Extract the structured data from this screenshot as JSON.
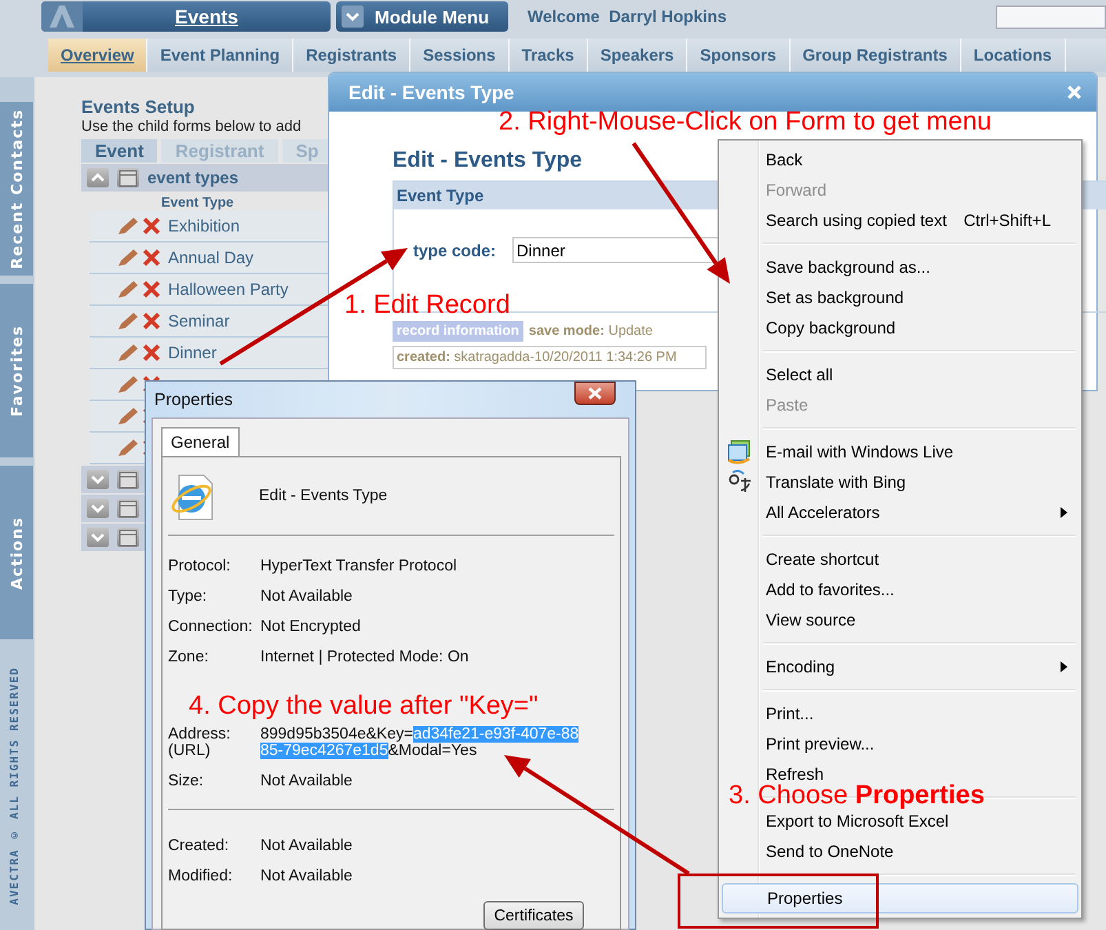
{
  "header": {
    "module": "Events",
    "module_menu": "Module Menu",
    "welcome": "Welcome  Darryl Hopkins"
  },
  "tabs": [
    {
      "label": "Overview",
      "selected": true
    },
    {
      "label": "Event Planning",
      "selected": false
    },
    {
      "label": "Registrants",
      "selected": false
    },
    {
      "label": "Sessions",
      "selected": false
    },
    {
      "label": "Tracks",
      "selected": false
    },
    {
      "label": "Speakers",
      "selected": false
    },
    {
      "label": "Sponsors",
      "selected": false
    },
    {
      "label": "Group Registrants",
      "selected": false
    },
    {
      "label": "Locations",
      "selected": false
    }
  ],
  "sidebar": {
    "tabs": [
      "Recent Contacts",
      "Favorites",
      "Actions"
    ],
    "footer": "AVECTRA © ALL RIGHTS RESERVED"
  },
  "events_setup": {
    "title": "Events Setup",
    "description": "Use the child forms below to add",
    "subtabs": [
      {
        "label": "Event",
        "selected": true
      },
      {
        "label": "Registrant",
        "selected": false
      },
      {
        "label": "Sp",
        "selected": false
      }
    ],
    "sections": [
      {
        "title": "event types",
        "expanded": true,
        "column": "Event Type",
        "rows": [
          {
            "name": "Exhibition"
          },
          {
            "name": "Annual Day"
          },
          {
            "name": "Halloween Party"
          },
          {
            "name": "Seminar"
          },
          {
            "name": "Dinner"
          },
          {},
          {},
          {}
        ]
      },
      {
        "expanded": false
      },
      {
        "expanded": false
      },
      {
        "expanded": false
      }
    ]
  },
  "edit_dialog": {
    "title": "Edit - Events Type",
    "heading": "Edit - Events Type",
    "section": "Event Type",
    "field": {
      "label": "type code:",
      "value": "Dinner"
    },
    "record_info": {
      "label": "record information",
      "save_mode": "**save mode:** Update",
      "created": "**created:** skatragadda-10/20/2011 1:34:26 PM"
    }
  },
  "properties_dialog": {
    "title": "Properties",
    "tabs": [
      {
        "label": "General",
        "selected": true
      }
    ],
    "name": "Edit - Events Type",
    "fields": [
      {
        "kind": "field",
        "label": "Protocol:",
        "value": "HyperText Transfer Protocol"
      },
      {
        "kind": "field",
        "label": "Type:",
        "value": "Not Available"
      },
      {
        "kind": "field",
        "label": "Connection:",
        "value": "Not Encrypted"
      },
      {
        "kind": "field",
        "label": "Zone:",
        "value": "Internet | Protected Mode: On"
      },
      {
        "kind": "address",
        "label": "Address:",
        "sublabel": "(URL)",
        "parts": [
          {
            "text": "899d95b3504e&Key=",
            "selected": false
          },
          {
            "text": "ad34fe21-e93f-407e-8885-79ec4267e1d5",
            "selected": true
          },
          {
            "text": "&Modal=Yes",
            "selected": false
          }
        ]
      },
      {
        "kind": "field",
        "label": "Size:",
        "value": "Not Available"
      },
      {
        "kind": "separator"
      },
      {
        "kind": "field",
        "label": "Created:",
        "value": "Not Available"
      },
      {
        "kind": "field",
        "label": "Modified:",
        "value": "Not Available"
      }
    ],
    "buttons": [
      "Certificates"
    ]
  },
  "context_menu": {
    "items": [
      {
        "kind": "item",
        "label": "Back",
        "disabled": false,
        "selected": false,
        "submenu": false
      },
      {
        "kind": "item",
        "label": "Forward",
        "disabled": true,
        "selected": false,
        "submenu": false
      },
      {
        "kind": "item",
        "label": "Search using copied text",
        "shortcut": "Ctrl+Shift+L",
        "disabled": false,
        "selected": false,
        "submenu": false
      },
      {
        "kind": "separator"
      },
      {
        "kind": "item",
        "label": "Save background as...",
        "disabled": false,
        "selected": false,
        "submenu": false
      },
      {
        "kind": "item",
        "label": "Set as background",
        "disabled": false,
        "selected": false,
        "submenu": false
      },
      {
        "kind": "item",
        "label": "Copy background",
        "disabled": false,
        "selected": false,
        "submenu": false
      },
      {
        "kind": "separator"
      },
      {
        "kind": "item",
        "label": "Select all",
        "disabled": false,
        "selected": false,
        "submenu": false
      },
      {
        "kind": "item",
        "label": "Paste",
        "disabled": true,
        "selected": false,
        "submenu": false
      },
      {
        "kind": "separator"
      },
      {
        "kind": "icon-item",
        "label": "E-mail with Windows Live",
        "disabled": false,
        "selected": false,
        "submenu": false
      },
      {
        "kind": "icon-item",
        "label": "Translate with Bing",
        "disabled": false,
        "selected": false,
        "submenu": false
      },
      {
        "kind": "item",
        "label": "All Accelerators",
        "disabled": false,
        "selected": false,
        "submenu": true
      },
      {
        "kind": "separator"
      },
      {
        "kind": "item",
        "label": "Create shortcut",
        "disabled": false,
        "selected": false,
        "submenu": false
      },
      {
        "kind": "item",
        "label": "Add to favorites...",
        "disabled": false,
        "selected": false,
        "submenu": false
      },
      {
        "kind": "item",
        "label": "View source",
        "disabled": false,
        "selected": false,
        "submenu": false
      },
      {
        "kind": "separator"
      },
      {
        "kind": "item",
        "label": "Encoding",
        "disabled": false,
        "selected": false,
        "submenu": true
      },
      {
        "kind": "separator"
      },
      {
        "kind": "item",
        "label": "Print...",
        "disabled": false,
        "selected": false,
        "submenu": false
      },
      {
        "kind": "item",
        "label": "Print preview...",
        "disabled": false,
        "selected": false,
        "submenu": false
      },
      {
        "kind": "item",
        "label": "Refresh",
        "disabled": false,
        "selected": false,
        "submenu": false
      },
      {
        "kind": "separator"
      },
      {
        "kind": "item",
        "label": "Export to Microsoft Excel",
        "disabled": false,
        "selected": false,
        "submenu": false
      },
      {
        "kind": "item",
        "label": "Send to OneNote",
        "disabled": false,
        "selected": false,
        "submenu": false
      },
      {
        "kind": "separator"
      },
      {
        "kind": "item",
        "label": "Properties",
        "disabled": false,
        "selected": true,
        "submenu": false
      }
    ]
  },
  "annotations": [
    "1. Edit Record",
    "2. Right-Mouse-Click on Form to get menu",
    "3. Choose **Properties**",
    "4. Copy the value after \"Key=\""
  ]
}
